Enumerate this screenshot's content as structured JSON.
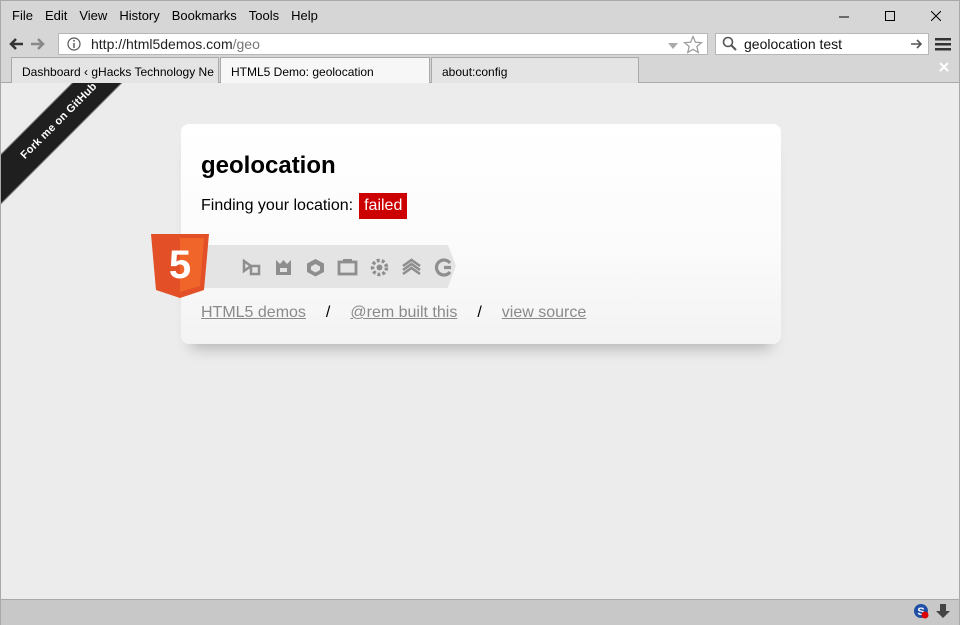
{
  "menu": {
    "items": [
      {
        "label": "File",
        "key": "F"
      },
      {
        "label": "Edit",
        "key": "E"
      },
      {
        "label": "View",
        "key": "V"
      },
      {
        "label": "History",
        "key": "s"
      },
      {
        "label": "Bookmarks",
        "key": "B"
      },
      {
        "label": "Tools",
        "key": "T"
      },
      {
        "label": "Help",
        "key": "H"
      }
    ]
  },
  "urlbar": {
    "host": "http://html5demos.com",
    "path": "/geo"
  },
  "search": {
    "value": "geolocation test"
  },
  "tabs": [
    {
      "label": "Dashboard ‹ gHacks Technology Ne"
    },
    {
      "label": "HTML5 Demo: geolocation"
    },
    {
      "label": "about:config"
    }
  ],
  "ribbon": {
    "label": "Fork me on GitHub"
  },
  "page": {
    "title": "geolocation",
    "status_prefix": "Finding your location:",
    "status_value": "failed",
    "links": {
      "demos": "HTML5 demos",
      "built": "@rem built this",
      "source": "view source"
    },
    "separator": "/",
    "html5_label": "5"
  },
  "colors": {
    "badge": "#cc0000",
    "html5": "#e34f26",
    "link": "#8a8a8a"
  }
}
